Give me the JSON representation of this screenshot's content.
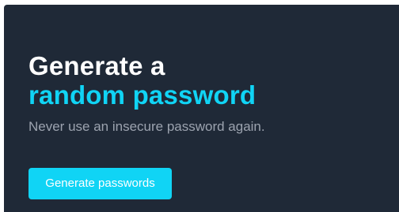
{
  "hero": {
    "title_line1": "Generate a",
    "title_line2": "random password",
    "subtitle": "Never use an insecure password again.",
    "cta_label": "Generate passwords"
  },
  "colors": {
    "background": "#1f2937",
    "accent": "#10d4f5",
    "title": "#ffffff",
    "subtitle": "#9ca3af",
    "button_text": "#ffffff"
  }
}
